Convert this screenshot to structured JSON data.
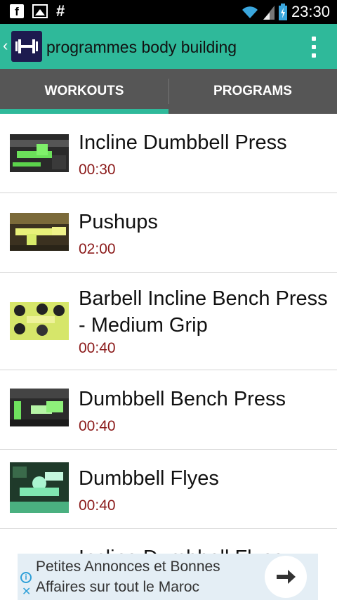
{
  "status_bar": {
    "icons": [
      "facebook-icon",
      "image-icon",
      "hash-icon"
    ],
    "right_icons": [
      "wifi-icon",
      "signal-icon",
      "battery-icon"
    ],
    "time": "23:30"
  },
  "action_bar": {
    "title": "programmes body building",
    "app_icon": "dumbbell-icon",
    "overflow_icon": "overflow-menu-icon",
    "accent": "#2fb99a"
  },
  "tabs": [
    {
      "label": "WORKOUTS",
      "active": true
    },
    {
      "label": "PROGRAMS",
      "active": false
    }
  ],
  "workouts": [
    {
      "name": "Incline Dumbbell Press",
      "time": "00:30"
    },
    {
      "name": "Pushups",
      "time": "02:00"
    },
    {
      "name": "Barbell Incline Bench Press - Medium Grip",
      "time": "00:40"
    },
    {
      "name": "Dumbbell Bench Press",
      "time": "00:40"
    },
    {
      "name": "Dumbbell Flyes",
      "time": "00:40"
    },
    {
      "name": "Incline Dumbbell Flyes",
      "time": ""
    }
  ],
  "ad": {
    "text": "Petites Annonces et Bonnes Affaires sur tout le Maroc",
    "info_icon": "info-icon",
    "close_icon": "close-icon",
    "arrow_icon": "arrow-right-icon"
  },
  "colors": {
    "time_text": "#8b1a1a",
    "tab_bg": "#565656",
    "status_bg": "#000000"
  }
}
